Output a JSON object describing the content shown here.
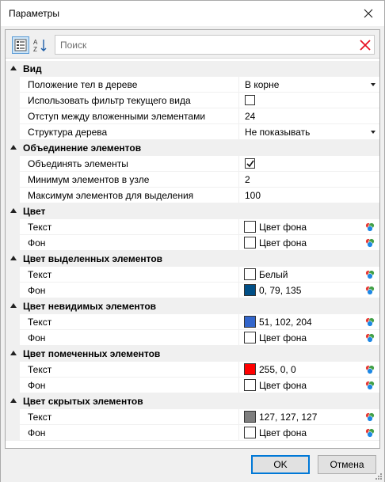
{
  "window": {
    "title": "Параметры"
  },
  "toolbar": {
    "search_placeholder": "Поиск",
    "sort_alpha_label": "AZ"
  },
  "categories": [
    {
      "label": "Вид",
      "rows": [
        {
          "name": "Положение тел в дереве",
          "type": "dropdown",
          "value": "В корне"
        },
        {
          "name": "Использовать фильтр текущего вида",
          "type": "checkbox",
          "checked": false
        },
        {
          "name": "Отступ между вложенными элементами",
          "type": "text",
          "value": "24"
        },
        {
          "name": "Структура дерева",
          "type": "dropdown",
          "value": "Не показывать"
        }
      ]
    },
    {
      "label": "Объединение элементов",
      "rows": [
        {
          "name": "Объединять элементы",
          "type": "checkbox",
          "checked": true
        },
        {
          "name": "Минимум элементов в узле",
          "type": "text",
          "value": "2"
        },
        {
          "name": "Максимум элементов для выделения",
          "type": "text",
          "value": "100"
        }
      ]
    },
    {
      "label": "Цвет",
      "rows": [
        {
          "name": "Текст",
          "type": "color",
          "value": "Цвет фона",
          "swatch": "#ffffff"
        },
        {
          "name": "Фон",
          "type": "color",
          "value": "Цвет фона",
          "swatch": "#ffffff"
        }
      ]
    },
    {
      "label": "Цвет выделенных элементов",
      "rows": [
        {
          "name": "Текст",
          "type": "color",
          "value": "Белый",
          "swatch": "#ffffff"
        },
        {
          "name": "Фон",
          "type": "color",
          "value": "0, 79, 135",
          "swatch": "#004f87"
        }
      ]
    },
    {
      "label": "Цвет невидимых элементов",
      "rows": [
        {
          "name": "Текст",
          "type": "color",
          "value": "51, 102, 204",
          "swatch": "#3366cc"
        },
        {
          "name": "Фон",
          "type": "color",
          "value": "Цвет фона",
          "swatch": "#ffffff"
        }
      ]
    },
    {
      "label": "Цвет помеченных элементов",
      "rows": [
        {
          "name": "Текст",
          "type": "color",
          "value": "255, 0, 0",
          "swatch": "#ff0000"
        },
        {
          "name": "Фон",
          "type": "color",
          "value": "Цвет фона",
          "swatch": "#ffffff"
        }
      ]
    },
    {
      "label": "Цвет скрытых элементов",
      "rows": [
        {
          "name": "Текст",
          "type": "color",
          "value": "127, 127, 127",
          "swatch": "#7f7f7f"
        },
        {
          "name": "Фон",
          "type": "color",
          "value": "Цвет фона",
          "swatch": "#ffffff"
        }
      ]
    }
  ],
  "footer": {
    "ok_label": "OK",
    "cancel_label": "Отмена"
  },
  "colors": {
    "accent": "#0078d7",
    "clear_icon": "#e81123",
    "category_bg": "#f0f0f0"
  },
  "icons": {
    "close": "close-icon",
    "categorized": "categorized-view-icon",
    "alphabetical": "sort-alphabetical-icon",
    "clear": "clear-search-icon",
    "palette": "color-palette-icon",
    "dropdown": "dropdown-arrow-icon"
  }
}
